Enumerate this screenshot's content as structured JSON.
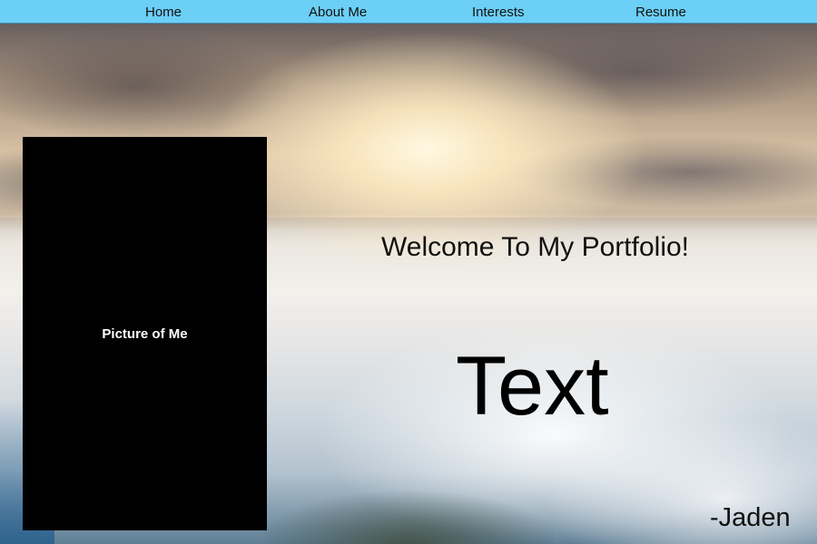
{
  "nav": {
    "items": [
      {
        "label": "Home"
      },
      {
        "label": "About Me"
      },
      {
        "label": "Interests"
      },
      {
        "label": "Resume"
      }
    ],
    "background_color": "#6ccff6"
  },
  "picture": {
    "label": "Picture of Me",
    "background_color": "#000000"
  },
  "main": {
    "welcome": "Welcome To My Portfolio!",
    "body_text": "Text",
    "signature": "-Jaden"
  }
}
